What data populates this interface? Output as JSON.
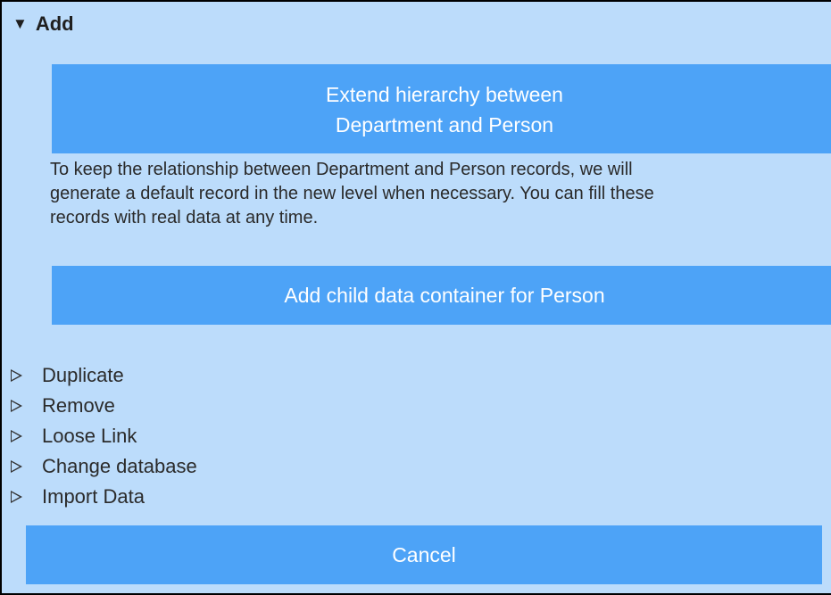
{
  "section": {
    "title": "Add",
    "expanded_icon": "triangle-down-icon"
  },
  "extend_button": {
    "line1": "Extend hierarchy between",
    "line2": "Department and Person"
  },
  "info_text": {
    "line1": "To keep the relationship between Department and Person records, we will",
    "line2": "generate a default record in the new level when necessary. You can fill these",
    "line3": "records with real data at any time."
  },
  "child_button": {
    "label": "Add child data container for Person"
  },
  "menu": {
    "items": [
      {
        "label": "Duplicate",
        "icon": "triangle-right-icon"
      },
      {
        "label": "Remove",
        "icon": "triangle-right-icon"
      },
      {
        "label": "Loose Link",
        "icon": "triangle-right-icon"
      },
      {
        "label": "Change database",
        "icon": "triangle-right-icon"
      },
      {
        "label": "Import Data",
        "icon": "triangle-right-icon"
      }
    ]
  },
  "cancel_button": {
    "label": "Cancel"
  },
  "colors": {
    "panel_background": "#bcdcfb",
    "button_background": "#4da3f7",
    "button_text": "#ffffff"
  }
}
